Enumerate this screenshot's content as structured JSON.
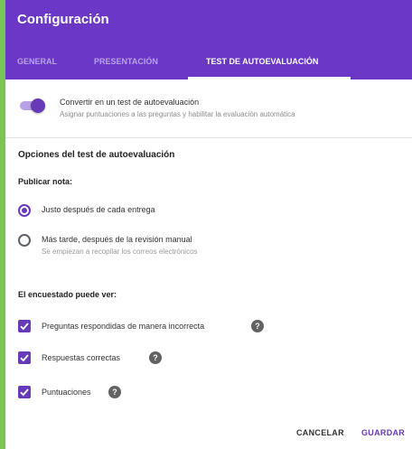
{
  "dialog": {
    "title": "Configuración",
    "tabs": [
      {
        "label": "GENERAL",
        "active": false
      },
      {
        "label": "PRESENTACIÓN",
        "active": false
      },
      {
        "label": "TEST DE AUTOEVALUACIÓN",
        "active": true
      }
    ]
  },
  "quiz_toggle": {
    "label": "Convertir en un test de autoevaluación",
    "description": "Asignar puntuaciones a las preguntas y habilitar la evaluación automática",
    "enabled": true
  },
  "options": {
    "section_title": "Opciones del test de autoevaluación",
    "release_grade": {
      "title": "Publicar nota:",
      "choices": [
        {
          "label": "Justo después de cada entrega",
          "selected": true
        },
        {
          "label": "Más tarde, después de la revisión manual",
          "description": "Se empiezan a recopilar los correos electrónicos",
          "selected": false
        }
      ]
    },
    "respondent_can_see": {
      "title": "El encuestado puede ver:",
      "items": [
        {
          "label": "Preguntas respondidas de manera incorrecta",
          "checked": true,
          "help": "?"
        },
        {
          "label": "Respuestas correctas",
          "checked": true,
          "help": "?"
        },
        {
          "label": "Puntuaciones",
          "checked": true,
          "help": "?"
        }
      ]
    }
  },
  "footer": {
    "cancel_label": "CANCELAR",
    "save_label": "GUARDAR"
  },
  "colors": {
    "accent": "#673ab7",
    "header": "#6a37c6",
    "background": "#7cc25a"
  }
}
